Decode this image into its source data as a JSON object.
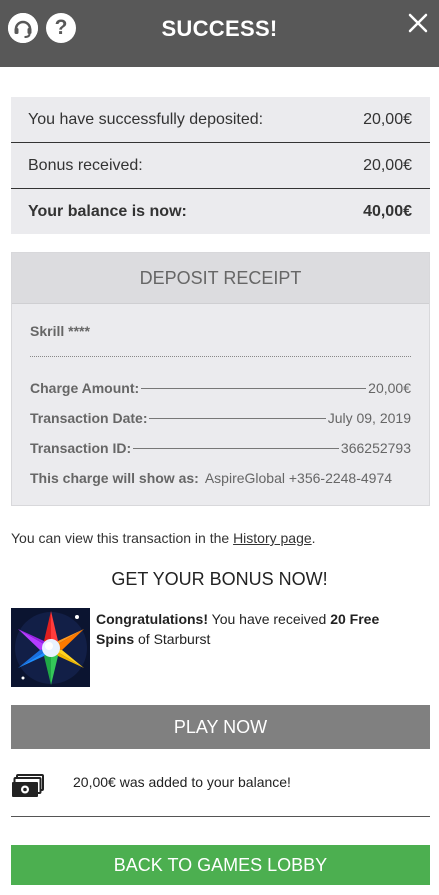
{
  "header": {
    "title": "SUCCESS!",
    "support_icon": "headset-support-icon",
    "help_icon": "question-icon",
    "help_glyph": "?",
    "close_icon": "close-icon",
    "background_color": "#585858"
  },
  "summary": {
    "rows": [
      {
        "label": "You have successfully deposited:",
        "value": "20,00€"
      },
      {
        "label": "Bonus received:",
        "value": "20,00€"
      },
      {
        "label": "Your balance is now:",
        "value": "40,00€"
      }
    ]
  },
  "receipt": {
    "title": "DEPOSIT RECEIPT",
    "method": "Skrill ****",
    "rows": [
      {
        "label": "Charge Amount:",
        "value": "20,00€"
      },
      {
        "label": "Transaction Date:",
        "value": "July 09, 2019"
      },
      {
        "label": "Transaction ID:",
        "value": "366252793"
      },
      {
        "label": "This charge will show as:",
        "value": "AspireGlobal +356-2248-4974"
      }
    ]
  },
  "info": {
    "prefix": "You can view this transaction in the ",
    "link": "History page",
    "suffix": "."
  },
  "bonus": {
    "title": "GET YOUR BONUS NOW!",
    "lead": "Congratulations!",
    "text1": " You have received ",
    "count": "20 Free Spins",
    "text2": " of Starburst",
    "game_icon": "starburst-game-icon",
    "play_label": "PLAY NOW"
  },
  "balance_notice": {
    "icon": "money-icon",
    "text": "20,00€ was added to your balance!"
  },
  "footer": {
    "lobby_label": "BACK TO GAMES LOBBY",
    "lobby_color": "#4caf50"
  }
}
